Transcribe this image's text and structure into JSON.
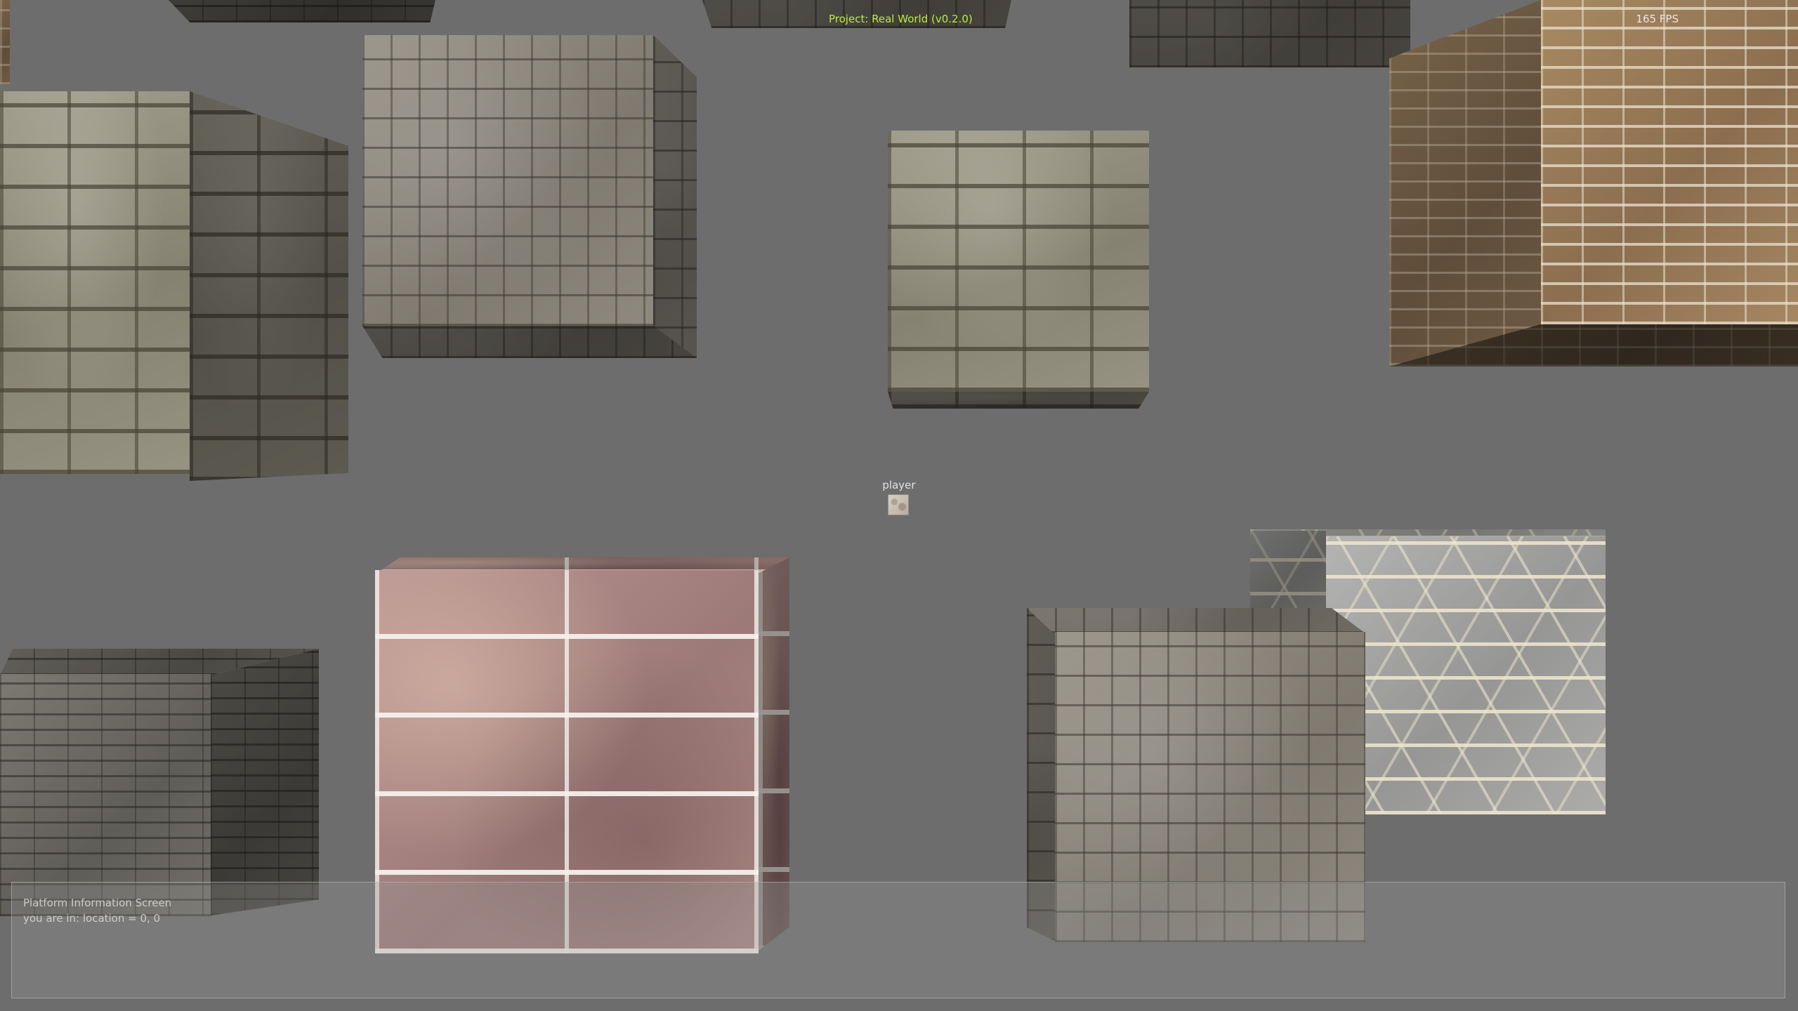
{
  "hud": {
    "title": "Project: Real World (v0.2.0)",
    "fps": "165 FPS",
    "title_color": "#b8f03a"
  },
  "player": {
    "label": "player"
  },
  "info_panel": {
    "title": "Platform Information Screen",
    "location": "you are in: location = 0, 0"
  },
  "background_color": "#6d6d6d"
}
